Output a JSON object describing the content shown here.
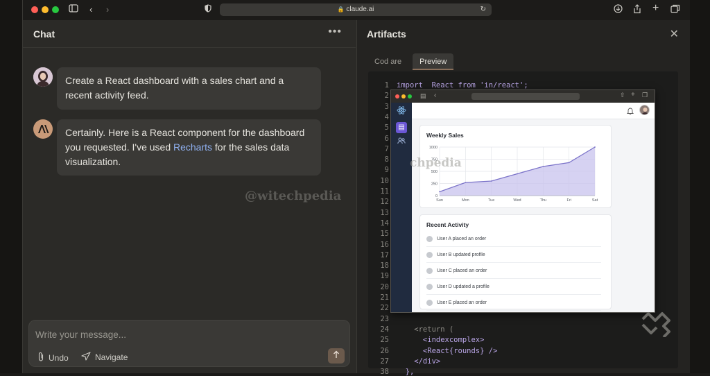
{
  "browser": {
    "url": "claude.ai",
    "traffic_lights": {
      "close": "#ff5f57",
      "minimize": "#febc2e",
      "maximize": "#28c840"
    }
  },
  "chat": {
    "title": "Chat",
    "messages": [
      {
        "role": "user",
        "avatar": "user-avatar",
        "text": "Create a React dashboard with a sales chart and a recent activity feed."
      },
      {
        "role": "assistant",
        "avatar": "anthropic-logo",
        "text_before": "Certainly. Here is a React component for the dashboard you requested. I've used ",
        "link": "Recharts",
        "text_after": " for the sales data visualization."
      }
    ],
    "watermark": "@witechpedia",
    "composer": {
      "placeholder": "Write your message...",
      "undo_label": "Undo",
      "navigate_label": "Navigate"
    }
  },
  "artifacts": {
    "title": "Artifacts",
    "tabs": [
      {
        "label": "Cod are",
        "active": false
      },
      {
        "label": "Preview",
        "active": true
      }
    ],
    "code": {
      "line_numbers": [
        1,
        2,
        3,
        4,
        5,
        6,
        7,
        8,
        9,
        10,
        11,
        12,
        13,
        14,
        15,
        16,
        17,
        18,
        19,
        20,
        21,
        22,
        23,
        24,
        25,
        26,
        27,
        38
      ],
      "first_line": "import  React from 'in/react';",
      "tail_lines": [
        {
          "num": 24,
          "text": "    <return ("
        },
        {
          "num": 25,
          "text": "      <indexcomplex>"
        },
        {
          "num": 26,
          "text": "      <React{rounds} />"
        },
        {
          "num": 27,
          "text": "    </div>"
        },
        {
          "num": 38,
          "text": "  },"
        }
      ]
    },
    "preview": {
      "watermark": "chpedia",
      "sales_card": {
        "title": "Weekly Sales",
        "chart_data": {
          "type": "area",
          "categories": [
            "Sun",
            "Mon",
            "Tue",
            "Wed",
            "Thu",
            "Fri",
            "Sat"
          ],
          "values": [
            80,
            270,
            300,
            450,
            600,
            680,
            1000
          ],
          "y_ticks": [
            0,
            250,
            500,
            750,
            1000
          ],
          "ylim": [
            0,
            1000
          ],
          "grid": true,
          "line_color": "#7b73c9",
          "fill_color": "#c8c3ee"
        }
      },
      "activity_card": {
        "title": "Recent Activity",
        "items": [
          "User A placed an order",
          "User B updated profile",
          "User C placed an order",
          "User D updated a profile",
          "User E placed an order"
        ]
      }
    }
  }
}
